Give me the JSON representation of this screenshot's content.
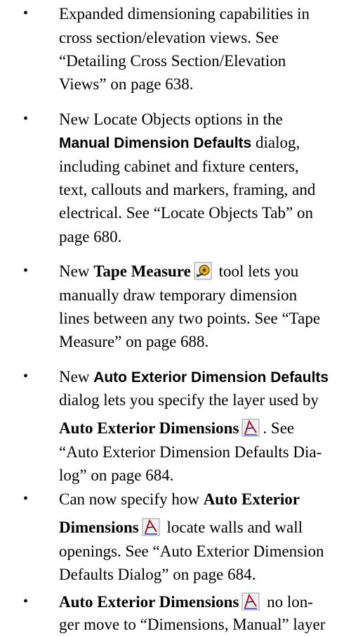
{
  "bullets": [
    {
      "lines": [
        "Expanded dimensioning capabilities in",
        "cross section/elevation views. See",
        "“Detailing Cross Section/Elevation",
        "Views” on page 638."
      ]
    },
    {
      "l1": "New Locate Objects options in the",
      "l2_bold": "Manual Dimension Defaults",
      "l2_rest": " dialog,",
      "lines": [
        "including cabinet and fixture centers,",
        "text, callouts and  markers, framing, and",
        "electrical. See “Locate Objects Tab” on",
        "page 680."
      ]
    },
    {
      "l1_pre": "New ",
      "l1_bold": "Tape Measure",
      "l1_post": " tool lets you",
      "icon": "tape-measure-icon",
      "lines": [
        "manually draw temporary dimension",
        "lines between any two points. See “Tape",
        "Measure” on page 688."
      ]
    },
    {
      "l1_pre": "New ",
      "l1_bold": "Auto Exterior Dimension Defaults",
      "l2": "dialog lets you specify the layer used by",
      "l3_bold": "Auto Exterior Dimensions",
      "l3_post": ". See",
      "icon": "auto-exterior-dimensions-icon",
      "lines": [
        "“Auto Exterior Dimension Defaults Dia-",
        "log” on page 684."
      ]
    },
    {
      "l1_pre": "Can now specify how ",
      "l1_bold": "Auto Exterior",
      "l2_bold": "Dimensions",
      "l2_post": " locate walls and wall",
      "icon": "auto-exterior-dimensions-icon",
      "lines": [
        "openings. See “Auto Exterior Dimension",
        "Defaults Dialog” on page 684."
      ]
    },
    {
      "l1_bold": "Auto Exterior Dimensions",
      "l1_post": " no lon-",
      "icon": "auto-exterior-dimensions-icon",
      "lines": [
        "ger move to “Dimensions, Manual” layer"
      ]
    }
  ],
  "bullet_char": "•"
}
